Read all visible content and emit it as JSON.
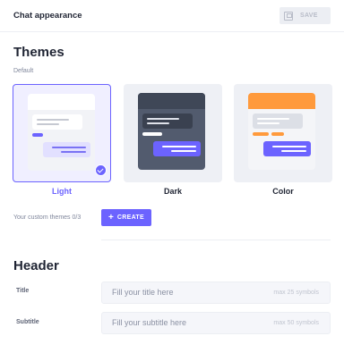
{
  "topbar": {
    "title": "Chat appearance",
    "save_label": "SAVE"
  },
  "themes_section": {
    "heading": "Themes",
    "sublabel": "Default",
    "options": [
      {
        "name": "Light",
        "selected": true
      },
      {
        "name": "Dark",
        "selected": false
      },
      {
        "name": "Color",
        "selected": false
      }
    ],
    "custom_label": "Your custom themes 0/3",
    "create_label": "CREATE"
  },
  "header_section": {
    "heading": "Header",
    "fields": [
      {
        "label": "Title",
        "placeholder": "Fill your title here",
        "hint": "max 25 symbols",
        "value": ""
      },
      {
        "label": "Subtitle",
        "placeholder": "Fill your subtitle here",
        "hint": "max 50 symbols",
        "value": ""
      }
    ]
  },
  "colors": {
    "accent": "#6c63ff",
    "orange": "#ff9a3c",
    "dark": "#3f4757"
  }
}
